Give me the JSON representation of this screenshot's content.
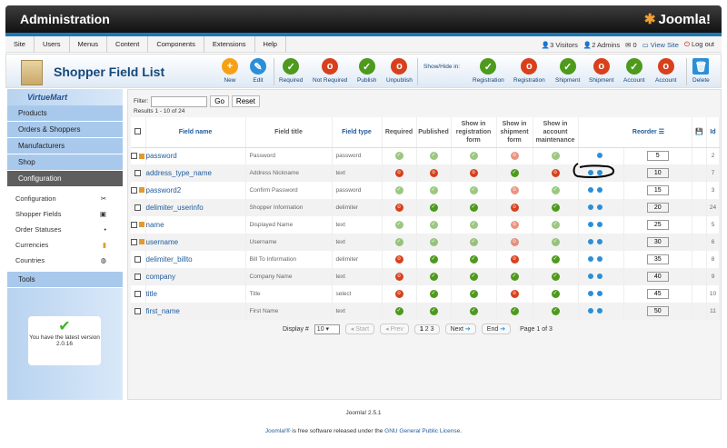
{
  "header": {
    "title": "Administration",
    "logo": "Joomla!"
  },
  "menu": [
    "Site",
    "Users",
    "Menus",
    "Content",
    "Components",
    "Extensions",
    "Help"
  ],
  "status": {
    "visitors": "3 Visitors",
    "admins": "2 Admins",
    "messages": "0",
    "view_site": "View Site",
    "logout": "Log out"
  },
  "toolbar": {
    "title": "Shopper Field List",
    "buttons": [
      "New",
      "Edit",
      "Required",
      "Not Required",
      "Publish",
      "Unpublish"
    ],
    "show_hide": "Show/Hide in:",
    "sh_buttons": [
      "Registration",
      "Registration",
      "Shipment",
      "Shipment",
      "Account",
      "Account"
    ],
    "delete": "Delete"
  },
  "sidebar": {
    "brand": "VirtueMart",
    "items": [
      "Products",
      "Orders & Shoppers",
      "Manufacturers",
      "Shop",
      "Configuration"
    ],
    "sub": [
      "Configuration",
      "Shopper Fields",
      "Order Statuses",
      "Currencies",
      "Countries"
    ],
    "tools": "Tools",
    "version_msg": "You have the latest version",
    "version": "2.0.16"
  },
  "filter": {
    "label": "Filter:",
    "value": "",
    "go": "Go",
    "reset": "Reset",
    "results": "Results 1 - 10 of 24"
  },
  "columns": [
    "Field name",
    "Field title",
    "Field type",
    "Required",
    "Published",
    "Show in registration form",
    "Show in shipment form",
    "Show in account maintenance",
    "Reorder",
    "Id"
  ],
  "rows": [
    {
      "name": "password",
      "title": "Password",
      "type": "password",
      "locked": true,
      "flags": [
        "g",
        "g",
        "g",
        "r",
        "g"
      ],
      "order": "5",
      "id": "2"
    },
    {
      "name": "address_type_name",
      "title": "Address Nickname",
      "type": "text",
      "locked": false,
      "flags": [
        "r",
        "r",
        "r",
        "g",
        "r"
      ],
      "order": "10",
      "id": "7"
    },
    {
      "name": "password2",
      "title": "Confirm Password",
      "type": "password",
      "locked": true,
      "flags": [
        "g",
        "g",
        "g",
        "r",
        "g"
      ],
      "order": "15",
      "id": "3"
    },
    {
      "name": "delimiter_userinfo",
      "title": "Shopper Information",
      "type": "delimiter",
      "locked": false,
      "flags": [
        "r",
        "g",
        "g",
        "r",
        "g"
      ],
      "order": "20",
      "id": "24"
    },
    {
      "name": "name",
      "title": "Displayed Name",
      "type": "text",
      "locked": true,
      "flags": [
        "g",
        "g",
        "g",
        "r",
        "g"
      ],
      "order": "25",
      "id": "5"
    },
    {
      "name": "username",
      "title": "Username",
      "type": "text",
      "locked": true,
      "flags": [
        "g",
        "g",
        "g",
        "r",
        "g"
      ],
      "order": "30",
      "id": "6"
    },
    {
      "name": "delimiter_billto",
      "title": "Bill To Information",
      "type": "delimiter",
      "locked": false,
      "flags": [
        "r",
        "g",
        "g",
        "r",
        "g"
      ],
      "order": "35",
      "id": "8"
    },
    {
      "name": "company",
      "title": "Company Name",
      "type": "text",
      "locked": false,
      "flags": [
        "r",
        "g",
        "g",
        "g",
        "g"
      ],
      "order": "40",
      "id": "9"
    },
    {
      "name": "title",
      "title": "Title",
      "type": "select",
      "locked": false,
      "flags": [
        "r",
        "g",
        "g",
        "r",
        "g"
      ],
      "order": "45",
      "id": "10"
    },
    {
      "name": "first_name",
      "title": "First Name",
      "type": "text",
      "locked": false,
      "flags": [
        "g",
        "g",
        "g",
        "g",
        "g"
      ],
      "order": "50",
      "id": "11"
    }
  ],
  "pager": {
    "display": "Display #",
    "limit": "10",
    "start": "Start",
    "prev": "Prev",
    "pages": [
      "1",
      "2",
      "3"
    ],
    "next": "Next",
    "end": "End",
    "info": "Page 1 of 3"
  },
  "footer": {
    "version": "Joomla! 2.5.1",
    "license_pre": "Joomla!®",
    "license_mid": " is free software released under the ",
    "license_link": "GNU General Public License",
    "license_post": "."
  }
}
